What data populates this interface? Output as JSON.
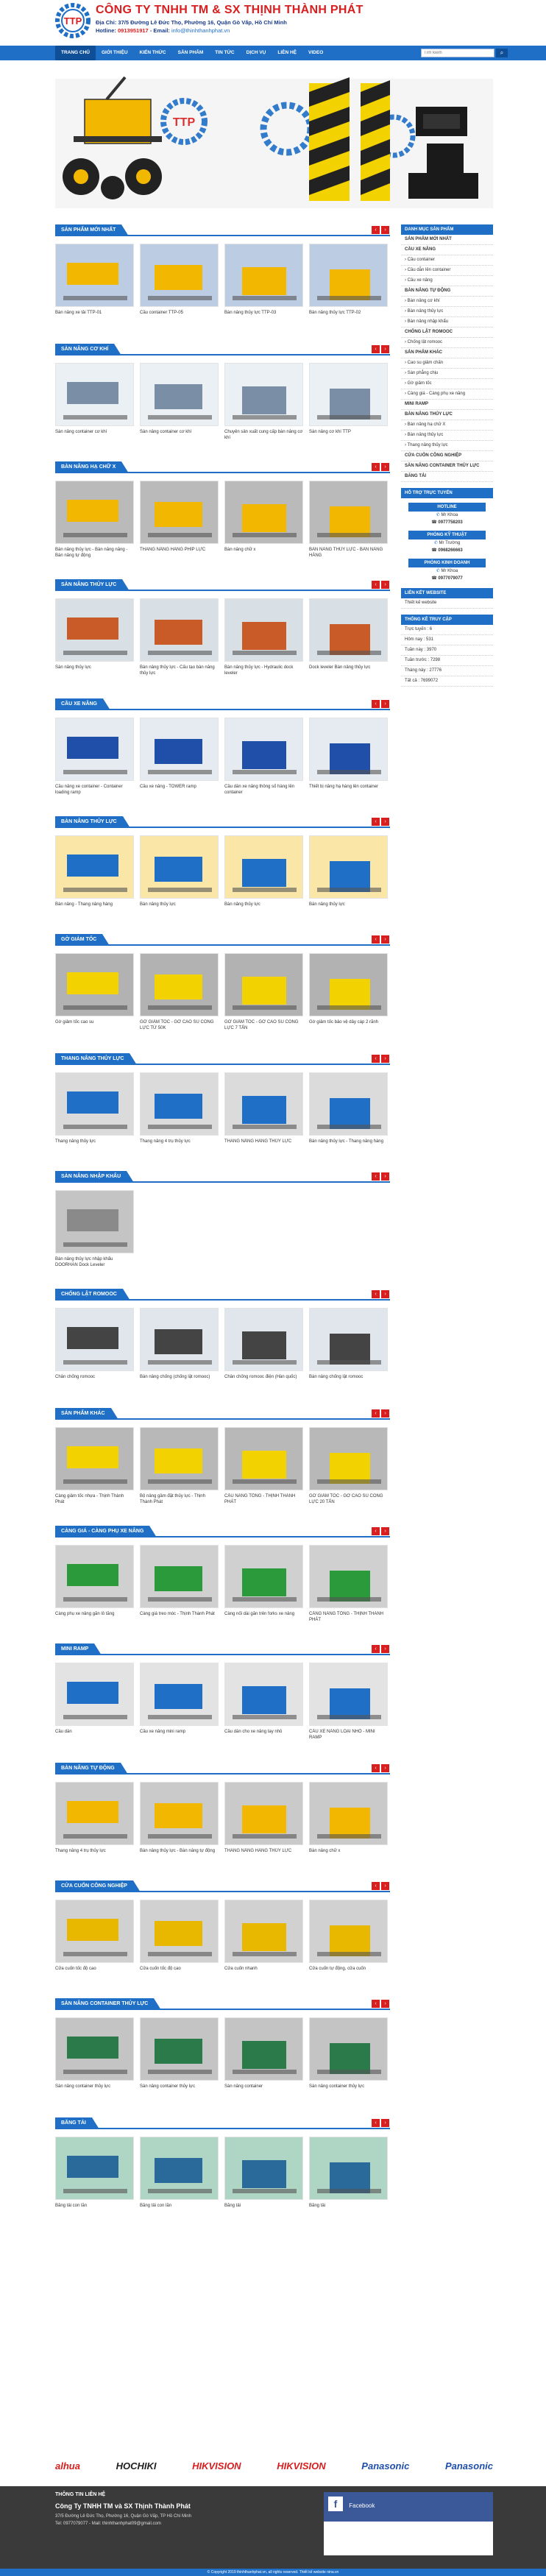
{
  "header": {
    "logo_text": "TTP",
    "company": "CÔNG TY TNHH TM & SX THỊNH THÀNH PHÁT",
    "address": "Địa Chỉ: 37/5 Đường Lê Đức Thọ, Phường 16, Quận Gò Vấp, Hồ Chí Minh",
    "hotline_label": "Hotline:",
    "hotline": "0913951917",
    "email_label": "- Email:",
    "email": "info@thinhthanhphat.vn"
  },
  "nav": {
    "items": [
      "TRANG CHỦ",
      "GIỚI THIỆU",
      "KIẾN THỨC",
      "SẢN PHẨM",
      "TIN TỨC",
      "DỊCH VỤ",
      "LIÊN HỆ",
      "VIDEO"
    ],
    "search_placeholder": "Tìm kiếm"
  },
  "banner": {
    "logo_text": "TTP"
  },
  "sections": [
    {
      "title": "Sản phẩm mới nhất",
      "items": [
        "Bàn nâng xe tải TTP-01",
        "Cầu container TTP-05",
        "Bàn nâng thủy lực TTP-03",
        "Bàn nâng thủy lực TTP-02"
      ]
    },
    {
      "title": "Sàn nâng cơ khí",
      "items": [
        "Sàn nâng container cơ khí",
        "Sàn nâng container cơ khí",
        "Chuyên sản xuất cung cấp bàn nâng cơ khí",
        "Sàn nâng cơ khí TTP"
      ]
    },
    {
      "title": "Bàn nâng hạ chữ X",
      "items": [
        "Bàn nâng thủy lực - Bàn nâng nâng - Bàn nâng tự động",
        "THANG NÂNG HÀNG PHÍP LỰC",
        "Bàn nâng chữ x",
        "BÀN NÂNG THỦY LỰC - BÀN NÂNG HÀNG"
      ]
    },
    {
      "title": "Sàn nâng thủy lực",
      "items": [
        "Sàn nâng thủy lực",
        "Bàn nâng thủy lực - Cấu tạo bàn nâng thủy lực",
        "Bàn nâng thủy lực - Hydraulic dock leveler",
        "Dock leveler Bàn nâng thủy lực"
      ]
    },
    {
      "title": "Cầu xe nâng",
      "items": [
        "Cầu nâng xe container - Container loading ramp",
        "Cầu xe nâng - TOWER ramp",
        "Cầu dẫn xe nâng thông số hàng lên container",
        "Thiết bị nâng hạ hàng lên container"
      ]
    },
    {
      "title": "Bàn nâng thủy lực",
      "items": [
        "Bàn nâng - Thang nâng hàng",
        "Bàn nâng thủy lực",
        "Bàn nâng thủy lực",
        "Bàn nâng thủy lực"
      ]
    },
    {
      "title": "Gờ giảm tốc",
      "items": [
        "Gờ giảm tốc cao su",
        "GỜ GIẢM TỐC - GỜ CAO SU CÔNG LỰC TỪ 50K",
        "GỜ GIẢM TỐC - GỜ CAO SU CÔNG LỰC 7 TẤN",
        "Gờ giảm tốc bảo vệ dây cáp 2 rãnh"
      ]
    },
    {
      "title": "Thang nâng thủy lực",
      "items": [
        "Thang nâng thủy lực",
        "Thang nâng 4 trụ thủy lực",
        "THANG NÂNG HÀNG THỦY LỰC",
        "Bàn nâng thủy lực - Thang nâng hàng"
      ]
    },
    {
      "title": "Sàn nâng nhập khẩu",
      "items": [
        "Bàn nâng thủy lực nhập khẩu DOORHAN Dock Leveler"
      ]
    },
    {
      "title": "Chống lật Romooc",
      "items": [
        "Chân chống romooc",
        "Bàn nâng chống (chống lật romooc)",
        "Chân chống romooc điện (Hàn quốc)",
        "Bàn nâng chống lật romooc"
      ]
    },
    {
      "title": "Sản phẩm khác",
      "items": [
        "Càng giảm tốc nhựa - Thịnh Thành Phát",
        "Bộ nâng gầm đặt thủy lực - Thịnh Thành Phát",
        "CẦU NÂNG TỔNG - THỊNH THÀNH PHÁT",
        "GỜ GIẢM TỐC - GỜ CAO SU CÔNG LỰC 20 TẤN"
      ]
    },
    {
      "title": "Càng giá - Càng phụ xe nâng",
      "items": [
        "Càng phụ xe nâng gắn lô tăng",
        "Càng giá treo móc - Thịnh Thành Phát",
        "Càng nối dài gắn trên forks xe nâng",
        "CẦNG NÂNG TỔNG - THỊNH THÀNH PHÁT"
      ]
    },
    {
      "title": "Mini ramp",
      "items": [
        "Cầu dẫn",
        "Cầu xe nâng mini ramp",
        "Cầu dẫn cho xe nâng tay nhỏ",
        "CẦU XE NÂNG LOẠI NHỎ - MINI RAMP"
      ]
    },
    {
      "title": "Bàn nâng tự động",
      "items": [
        "Thang nâng 4 trụ thủy lực",
        "Bàn nâng thủy lực - Bàn nâng tự động",
        "THANG NÂNG HÀNG THỦY LỰC",
        "Bàn nâng chữ x"
      ]
    },
    {
      "title": "Cửa cuốn công nghiệp",
      "items": [
        "Cửa cuốn tốc độ cao",
        "Cửa cuốn tốc độ cao",
        "Cửa cuốn nhanh",
        "Cửa cuốn tự động, cửa cuốn"
      ]
    },
    {
      "title": "Sàn nâng container thủy lực",
      "items": [
        "Sàn nâng container thủy lực",
        "Sàn nâng container thủy lực",
        "Sàn nâng container",
        "Sàn nâng container thủy lực"
      ]
    },
    {
      "title": "Băng tải",
      "items": [
        "Băng tải con lăn",
        "Băng tải con lăn",
        "Băng tải",
        "Băng tải"
      ]
    }
  ],
  "sidebar": {
    "cat_title": "DANH MỤC SẢN PHẨM",
    "cats": [
      {
        "label": "SẢN PHẨM MỚI NHẤT",
        "bold": true
      },
      {
        "label": "CẦU XE NÂNG",
        "bold": true
      },
      {
        "label": "› Cầu container",
        "bold": false
      },
      {
        "label": "› Cầu dẫn lên container",
        "bold": false
      },
      {
        "label": "› Cầu xe nâng",
        "bold": false
      },
      {
        "label": "BÀN NÂNG TỰ ĐỘNG",
        "bold": true
      },
      {
        "label": "› Bàn nâng cơ khí",
        "bold": false
      },
      {
        "label": "› Bàn nâng thủy lực",
        "bold": false
      },
      {
        "label": "› Bàn nâng nhập khẩu",
        "bold": false
      },
      {
        "label": "CHỐNG LẬT ROMOOC",
        "bold": true
      },
      {
        "label": "› Chống lật romooc",
        "bold": false
      },
      {
        "label": "SẢN PHẨM KHÁC",
        "bold": true
      },
      {
        "label": "› Cao su giảm chấn",
        "bold": false
      },
      {
        "label": "› Sàn phẳng chịu",
        "bold": false
      },
      {
        "label": "› Gờ giảm tốc",
        "bold": false
      },
      {
        "label": "› Càng giá - Càng phụ xe nâng",
        "bold": false
      },
      {
        "label": "MINI RAMP",
        "bold": true
      },
      {
        "label": "BÀN NÂNG THỦY LỰC",
        "bold": true
      },
      {
        "label": "› Bàn nâng hạ chữ X",
        "bold": false
      },
      {
        "label": "› Bàn nâng thủy lực",
        "bold": false
      },
      {
        "label": "› Thang nâng thủy lực",
        "bold": false
      },
      {
        "label": "CỬA CUỐN CÔNG NGHIỆP",
        "bold": true
      },
      {
        "label": "SÀN NÂNG CONTAINER THỦY LỰC",
        "bold": true
      },
      {
        "label": "BĂNG TẢI",
        "bold": true
      }
    ],
    "support_title": "HỖ TRỢ TRỰC TUYẾN",
    "support": [
      {
        "dept": "HOTLINE",
        "name": "Mr Khoa",
        "phone": "0977758203"
      },
      {
        "dept": "PHÒNG KỸ THUẬT",
        "name": "Mr Trường",
        "phone": "0968266663"
      },
      {
        "dept": "PHÒNG KINH DOANH",
        "name": "Mr Khoa",
        "phone": "0977079077"
      }
    ],
    "news_title": "LIÊN KẾT WEBSITE",
    "news": [
      "Thiết kế website"
    ],
    "stats_title": "THỐNG KÊ TRUY CẬP",
    "stats": [
      "Trực tuyến : 6",
      "Hôm nay : 531",
      "Tuần này : 3970",
      "Tuần trước : 7298",
      "Tháng này : 27776",
      "Tất cả : 7699072"
    ]
  },
  "brands": [
    "alhua",
    "HOCHIKI",
    "HIKVISION",
    "HIKVISION",
    "Panasonic",
    "Panasonic"
  ],
  "footer": {
    "title": "THÔNG TIN LIÊN HỆ",
    "company": "Công Ty TNHH TM và SX Thịnh Thành Phát",
    "address": "37/5 Đường Lê Đức Thọ, Phường 16, Quận Gò Vấp, TP Hồ Chí Minh",
    "phone": "Tel: 0977079077 - Mail: thinhthanhphat09@gmail.com",
    "fb": "Facebook",
    "copyright": "© Copyright 2019 thinhthanhphat.vn, all rights reserved. Thiết kế website nina.vn"
  }
}
